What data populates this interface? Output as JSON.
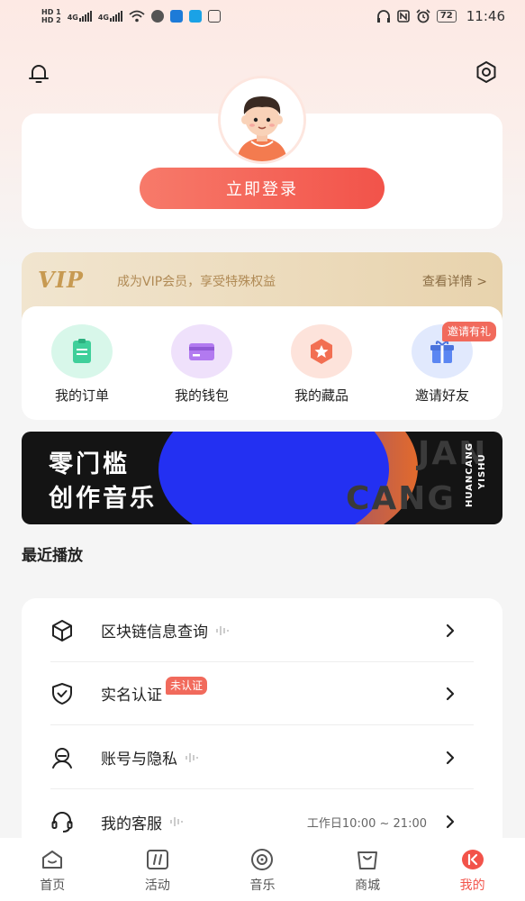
{
  "status_bar": {
    "left": [
      "HD 1",
      "HD 2",
      "4G",
      "4G"
    ],
    "battery": "72",
    "time": "11:46"
  },
  "header": {
    "bell_icon": "bell-icon",
    "settings_icon": "gear-icon"
  },
  "profile": {
    "avatar": "boy-avatar",
    "login_label": "立即登录"
  },
  "vip": {
    "logo": "VIP",
    "text": "成为VIP会员，享受特殊权益",
    "detail_label": "查看详情 >",
    "colors": {
      "text": "#b08a55",
      "logo": "#c79a52"
    }
  },
  "menu": {
    "items": [
      {
        "label": "我的订单",
        "icon": "order-clipboard-icon",
        "color": "#3fcf9a"
      },
      {
        "label": "我的钱包",
        "icon": "wallet-card-icon",
        "color": "#b27af0"
      },
      {
        "label": "我的藏品",
        "icon": "collection-star-icon",
        "color": "#f26f52"
      },
      {
        "label": "邀请好友",
        "icon": "gift-icon",
        "color": "#5b86f2"
      }
    ],
    "invite_badge": "邀请有礼"
  },
  "banner": {
    "line1": "零门槛",
    "line2": "创作音乐",
    "side_text_1": "HUANCANG",
    "side_text_2": "YISHU",
    "big_text_1": "JAN",
    "big_text_2": "CANG"
  },
  "recent": {
    "title": "最近播放"
  },
  "list": [
    {
      "label": "区块链信息查询",
      "icon": "cube-icon"
    },
    {
      "label": "实名认证",
      "icon": "shield-check-icon",
      "tag": "未认证"
    },
    {
      "label": "账号与隐私",
      "icon": "user-privacy-icon"
    },
    {
      "label": "我的客服",
      "icon": "headset-icon",
      "extra": "工作日10:00 ~ 21:00"
    }
  ],
  "tabs": [
    {
      "label": "首页",
      "icon": "home-icon"
    },
    {
      "label": "活动",
      "icon": "activity-icon"
    },
    {
      "label": "音乐",
      "icon": "music-disc-icon"
    },
    {
      "label": "商城",
      "icon": "shop-bag-icon"
    },
    {
      "label": "我的",
      "icon": "profile-icon",
      "active": true
    }
  ],
  "colors": {
    "accent": "#f2534a",
    "background": "#f5f5f5"
  }
}
